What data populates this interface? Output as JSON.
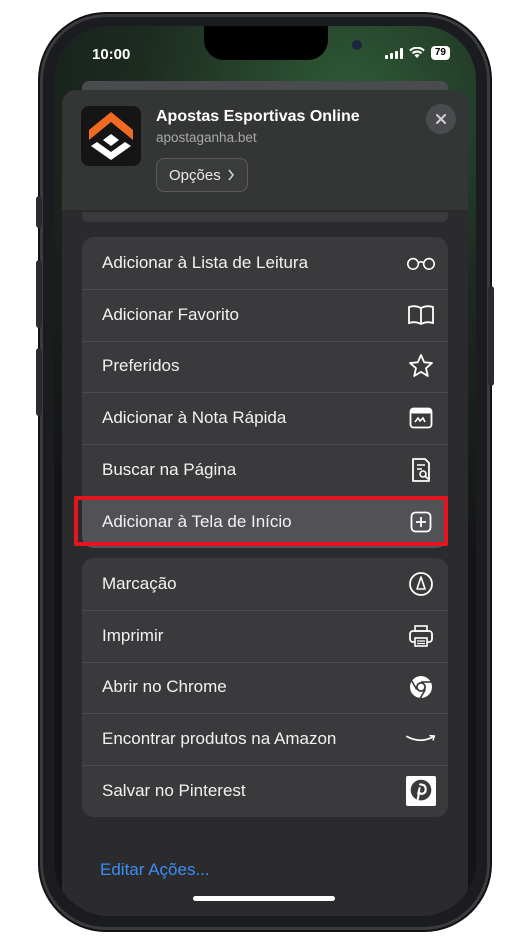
{
  "status": {
    "time": "10:00",
    "battery": "79"
  },
  "site": {
    "title": "Apostas Esportivas Online",
    "domain": "apostaganha.bet",
    "options_label": "Opções"
  },
  "group1": [
    {
      "label": "Adicionar à Lista de Leitura",
      "icon": "glasses-icon"
    },
    {
      "label": "Adicionar Favorito",
      "icon": "book-icon"
    },
    {
      "label": "Preferidos",
      "icon": "star-icon"
    },
    {
      "label": "Adicionar à Nota Rápida",
      "icon": "quick-note-icon"
    },
    {
      "label": "Buscar na Página",
      "icon": "find-in-page-icon"
    },
    {
      "label": "Adicionar à Tela de Início",
      "icon": "add-square-icon"
    }
  ],
  "group2": [
    {
      "label": "Marcação",
      "icon": "markup-icon"
    },
    {
      "label": "Imprimir",
      "icon": "printer-icon"
    },
    {
      "label": "Abrir no Chrome",
      "icon": "chrome-icon"
    },
    {
      "label": "Encontrar produtos na Amazon",
      "icon": "amazon-smile-icon"
    },
    {
      "label": "Salvar no Pinterest",
      "icon": "pinterest-icon"
    }
  ],
  "edit_actions": "Editar Ações...",
  "colors": {
    "accent": "#3b8df5",
    "highlight": "#e4151f",
    "sheet": "#2b2b2d",
    "row": "#3a3a3c"
  }
}
